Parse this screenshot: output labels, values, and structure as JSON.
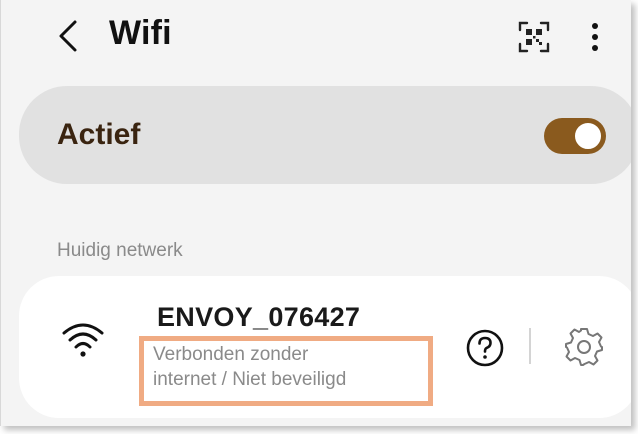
{
  "header": {
    "title": "Wifi",
    "back_icon": "chevron-left-icon",
    "qr_icon": "qr-scan-icon",
    "more_icon": "more-vertical-icon"
  },
  "wifi_toggle": {
    "label": "Actief",
    "enabled": true,
    "accent_color": "#8a5a1e"
  },
  "current_network": {
    "section_label": "Huidig netwerk",
    "ssid": "ENVOY_076427",
    "status_line1": "Verbonden zonder",
    "status_line2": "internet / Niet beveiligd",
    "signal_icon": "wifi-signal-icon",
    "help_icon": "help-circle-icon",
    "settings_icon": "gear-icon",
    "highlight_color": "#f0ab83"
  }
}
